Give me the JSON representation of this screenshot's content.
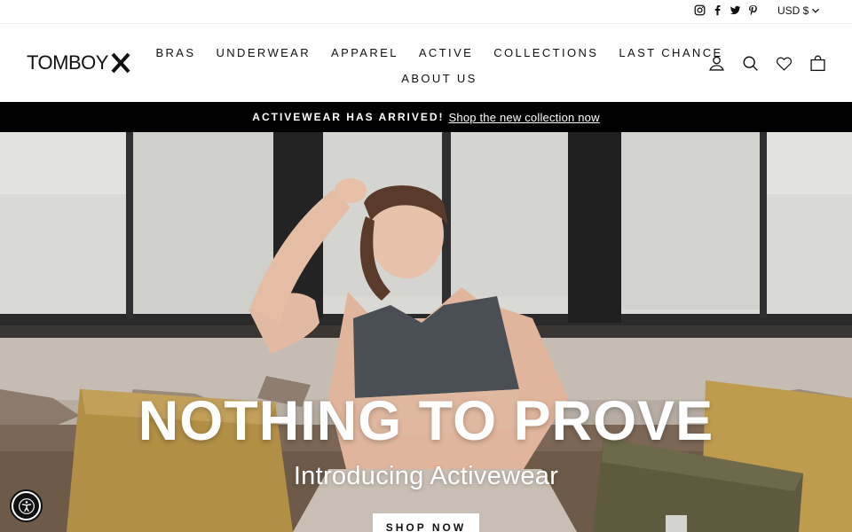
{
  "utility": {
    "social": [
      "instagram-icon",
      "facebook-icon",
      "twitter-icon",
      "pinterest-icon"
    ],
    "currency": "USD $"
  },
  "header": {
    "logo": "TOMBOY",
    "nav_row1": [
      "BRAS",
      "UNDERWEAR",
      "APPAREL",
      "ACTIVE",
      "COLLECTIONS",
      "LAST CHANCE"
    ],
    "nav_row2": [
      "ABOUT US"
    ],
    "icons": [
      "account-icon",
      "search-icon",
      "wishlist-heart-icon",
      "cart-bag-icon"
    ]
  },
  "announcement": {
    "strong": "ACTIVEWEAR HAS ARRIVED!",
    "link": "Shop the new collection now"
  },
  "hero": {
    "title": "NOTHING TO PROVE",
    "subtitle": "Introducing Activewear",
    "button": "SHOP NOW"
  },
  "accessibility": {
    "icon": "accessibility-icon"
  },
  "colors": {
    "brand_black": "#000000",
    "text": "#111111",
    "hero_overlay_text": "#ffffff"
  }
}
